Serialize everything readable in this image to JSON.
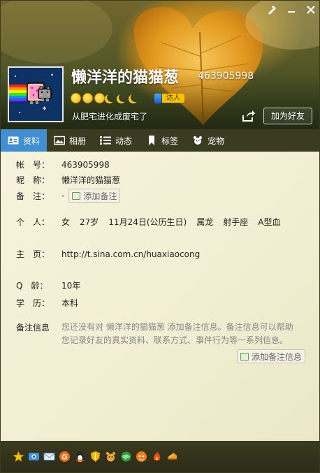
{
  "window": {
    "controls": [
      "skin-icon",
      "minimize-icon",
      "close-icon"
    ]
  },
  "profile": {
    "nickname": "懒洋洋的猫猫葱",
    "qq_number": "463905998",
    "badge_label": "达人",
    "signature": "从肥宅进化成废宅了",
    "add_friend_label": "加为好友",
    "level_icons": [
      "sun",
      "sun",
      "sun",
      "moon",
      "moon",
      "moon"
    ]
  },
  "tabs": [
    {
      "label": "资料",
      "icon": "id-card-icon",
      "active": true
    },
    {
      "label": "相册",
      "icon": "photo-icon",
      "active": false
    },
    {
      "label": "动态",
      "icon": "feed-icon",
      "active": false
    },
    {
      "label": "标签",
      "icon": "tag-icon",
      "active": false
    },
    {
      "label": "宠物",
      "icon": "pet-icon",
      "active": false
    }
  ],
  "info": {
    "account_label": "帐　号：",
    "account_value": "463905998",
    "nickname_label": "昵　称：",
    "nickname_value": "懒洋洋的猫猫葱",
    "remark_label": "备　注：",
    "remark_value": "-",
    "add_remark_label": "添加备注",
    "personal_label": "个　人：",
    "personal": {
      "gender": "女",
      "age": "27岁",
      "birthday": "11月24日(公历生日)",
      "zodiac": "属龙",
      "constellation": "射手座",
      "blood": "A型血"
    },
    "homepage_label": "主　页：",
    "homepage_value": "http://t.sina.com.cn/huaxiaocong",
    "qage_label": "Q　龄：",
    "qage_value": "10年",
    "education_label": "学　历：",
    "education_value": "本科",
    "note_info_label": "备注信息",
    "note_info_desc": "您还没有对 懒洋洋的猫猫葱 添加备注信息。备注信息可以帮助您记录好友的真实资料、联系方式、事件行为等一系列信息。",
    "add_note_label": "添加备注信息"
  },
  "bottom_icons": [
    "star-icon",
    "camera-icon",
    "mail-icon",
    "g-icon",
    "penguin-icon",
    "shield-icon",
    "pet-icon",
    "globe-icon",
    "fire-icon",
    "flame-icon",
    "shoe-icon"
  ],
  "colors": {
    "tab_active": "#3f8fd2",
    "tab_bar": "#3a3c22",
    "content_bg": "#f4f1d8",
    "badge": "#f5c400"
  }
}
